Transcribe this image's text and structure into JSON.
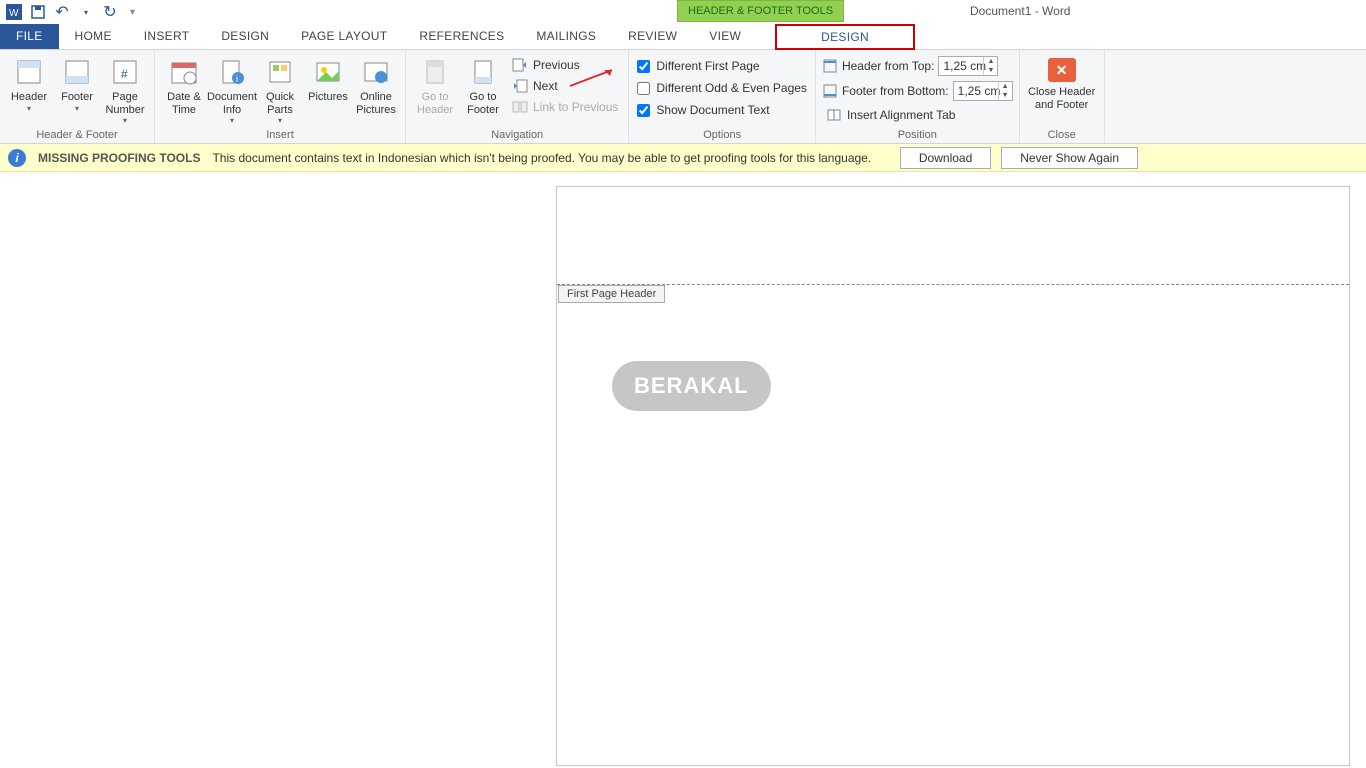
{
  "qat": {
    "undo": "↶",
    "redo": "↷"
  },
  "contextual_tab": "HEADER & FOOTER TOOLS",
  "document_title": "Document1 - Word",
  "tabs": {
    "file": "FILE",
    "home": "HOME",
    "insert": "INSERT",
    "design": "DESIGN",
    "page_layout": "PAGE LAYOUT",
    "references": "REFERENCES",
    "mailings": "MAILINGS",
    "review": "REVIEW",
    "view": "VIEW",
    "hf_design": "DESIGN"
  },
  "ribbon": {
    "groups": {
      "header_footer": {
        "label": "Header & Footer",
        "header": "Header",
        "footer": "Footer",
        "page_number": "Page Number"
      },
      "insert": {
        "label": "Insert",
        "date_time": "Date & Time",
        "doc_info": "Document Info",
        "quick_parts": "Quick Parts",
        "pictures": "Pictures",
        "online_pictures": "Online Pictures"
      },
      "navigation": {
        "label": "Navigation",
        "goto_header": "Go to Header",
        "goto_footer": "Go to Footer",
        "previous": "Previous",
        "next": "Next",
        "link": "Link to Previous"
      },
      "options": {
        "label": "Options",
        "diff_first": "Different First Page",
        "diff_odd": "Different Odd & Even Pages",
        "show_doc": "Show Document Text"
      },
      "position": {
        "label": "Position",
        "from_top": "Header from Top:",
        "from_bottom": "Footer from Bottom:",
        "align_tab": "Insert Alignment Tab",
        "top_val": "1,25 cm",
        "bottom_val": "1,25 cm"
      },
      "close": {
        "label": "Close",
        "btn": "Close Header and Footer"
      }
    }
  },
  "msgbar": {
    "title": "MISSING PROOFING TOOLS",
    "text": "This document contains text in Indonesian which isn't being proofed. You may be able to get proofing tools for this language.",
    "download": "Download",
    "never": "Never Show Again"
  },
  "page": {
    "header_tag": "First Page Header",
    "watermark": "BERAKAL"
  }
}
